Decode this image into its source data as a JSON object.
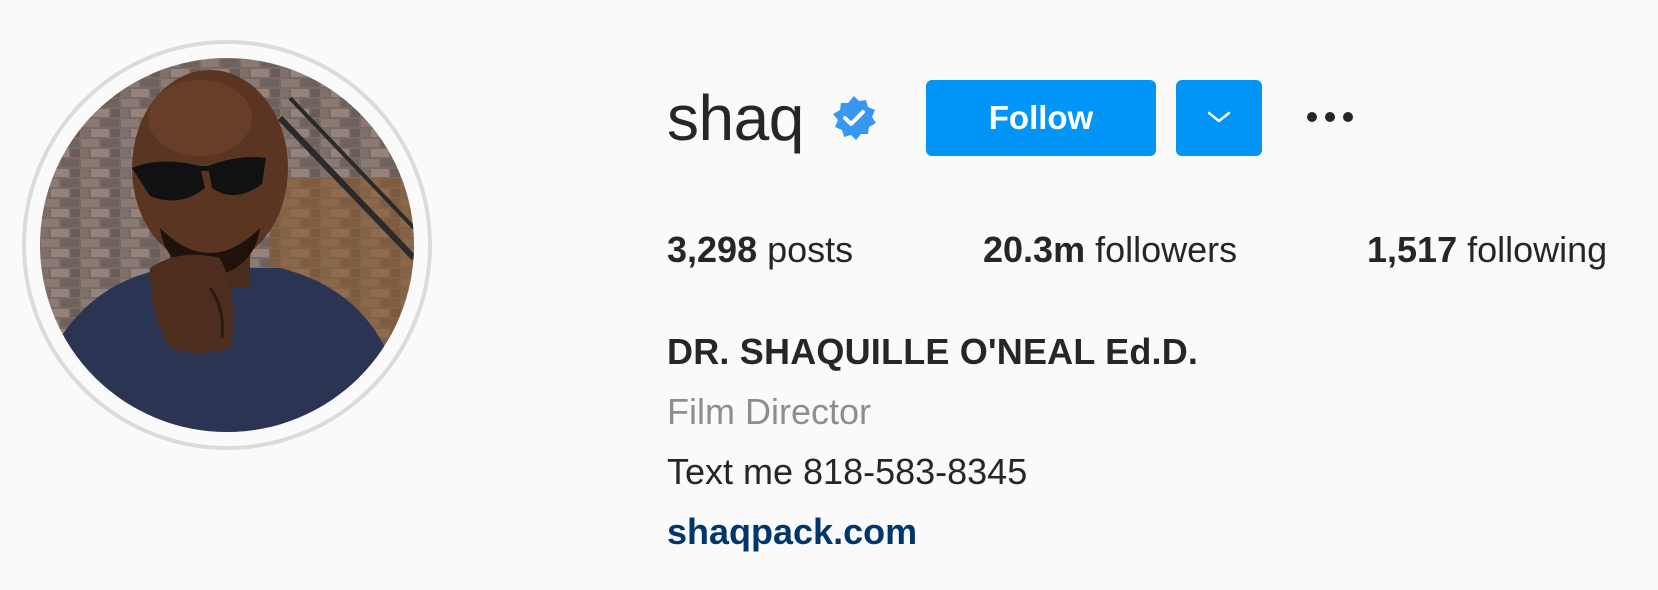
{
  "profile": {
    "username": "shaq",
    "verified": true,
    "full_name": "DR. SHAQUILLE O'NEAL Ed.D.",
    "category": "Film Director",
    "bio": "Text me 818-583-8345",
    "link": "shaqpack.com"
  },
  "actions": {
    "follow_label": "Follow",
    "dropdown_icon": "chevron-down-icon",
    "more_icon": "more-options-icon"
  },
  "stats": {
    "posts_count": "3,298",
    "posts_label": "posts",
    "followers_count": "20.3m",
    "followers_label": "followers",
    "following_count": "1,517",
    "following_label": "following"
  },
  "colors": {
    "accent": "#0095f6",
    "link": "#00376b",
    "secondary_text": "#8e8e8e",
    "verified_badge": "#3897f0"
  }
}
